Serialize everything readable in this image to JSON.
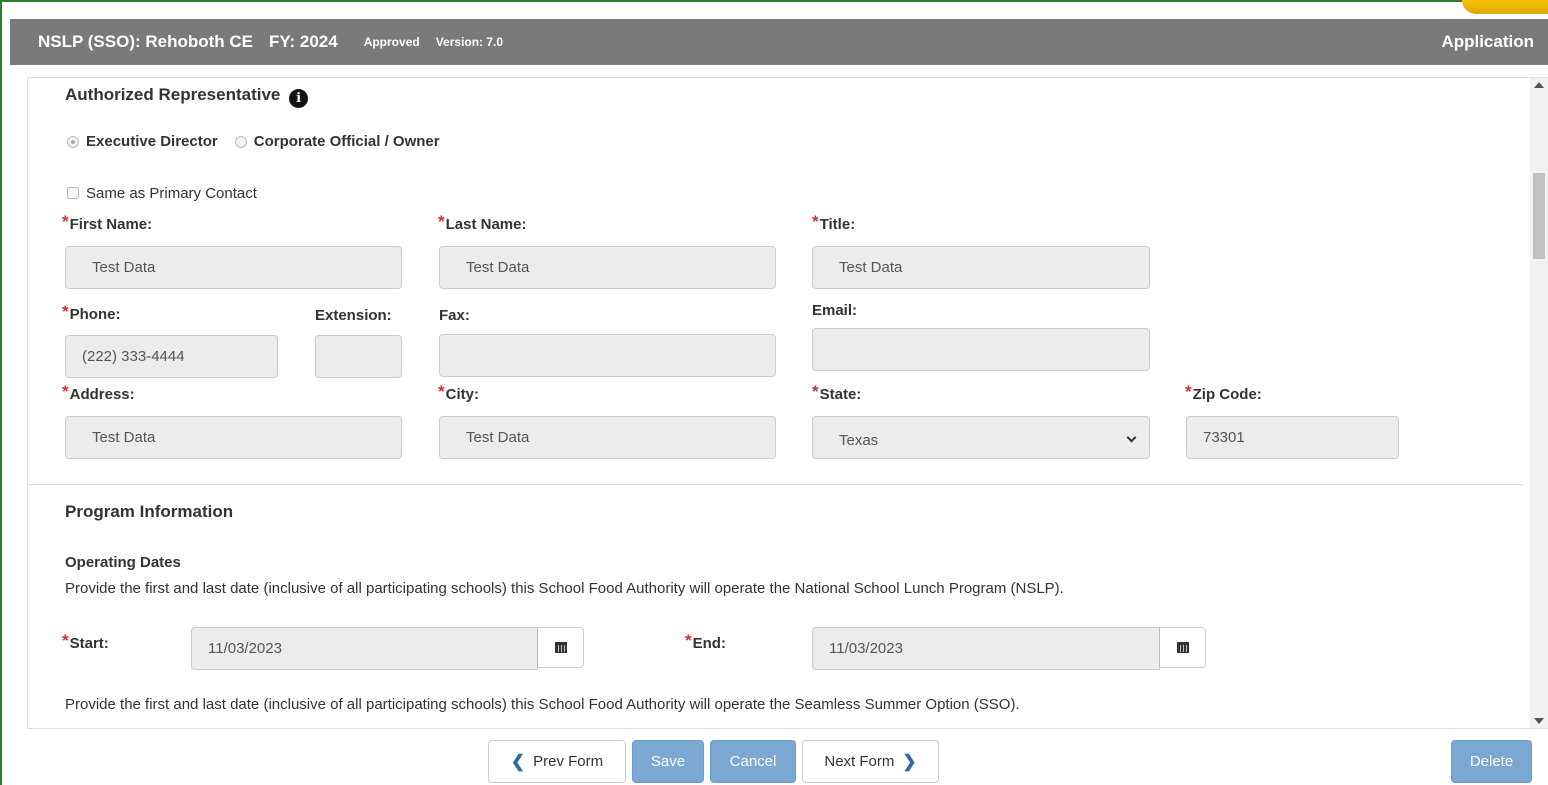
{
  "header": {
    "program": "NSLP (SSO): Rehoboth CE",
    "fiscal_year": "FY: 2024",
    "status": "Approved",
    "version": "Version: 7.0",
    "page_type": "Application"
  },
  "authorized_rep": {
    "title": "Authorized Representative",
    "options": [
      "Executive Director",
      "Corporate Official / Owner"
    ],
    "selected": "Executive Director",
    "same_as_primary_label": "Same as Primary Contact",
    "fields": {
      "first_name": {
        "label": "First Name:",
        "value": "Test Data",
        "required": true
      },
      "last_name": {
        "label": "Last Name:",
        "value": "Test Data",
        "required": true
      },
      "title": {
        "label": "Title:",
        "value": "Test Data",
        "required": true
      },
      "phone": {
        "label": "Phone:",
        "value": "(222) 333-4444",
        "required": true
      },
      "extension": {
        "label": "Extension:",
        "value": ""
      },
      "fax": {
        "label": "Fax:",
        "value": ""
      },
      "email": {
        "label": "Email:",
        "value": ""
      },
      "address": {
        "label": "Address:",
        "value": "Test Data",
        "required": true
      },
      "city": {
        "label": "City:",
        "value": "Test Data",
        "required": true
      },
      "state": {
        "label": "State:",
        "value": "Texas",
        "required": true
      },
      "zip": {
        "label": "Zip Code:",
        "value": "73301",
        "required": true
      }
    }
  },
  "program_info": {
    "title": "Program Information",
    "operating_dates_title": "Operating Dates",
    "nslp_text": "Provide the first and last date (inclusive of all participating schools) this School Food Authority will operate the National School Lunch Program (NSLP).",
    "start_label": "Start:",
    "start_value": "11/03/2023",
    "end_label": "End:",
    "end_value": "11/03/2023",
    "sso_text": "Provide the first and last date (inclusive of all participating schools) this School Food Authority will operate the Seamless Summer Option (SSO)."
  },
  "footer": {
    "prev": "Prev Form",
    "save": "Save",
    "cancel": "Cancel",
    "next": "Next Form",
    "delete": "Delete"
  },
  "icons": {
    "info": "info-circle-icon",
    "calendar": "calendar-icon",
    "prev": "chevron-left-icon",
    "next": "chevron-right-icon"
  }
}
